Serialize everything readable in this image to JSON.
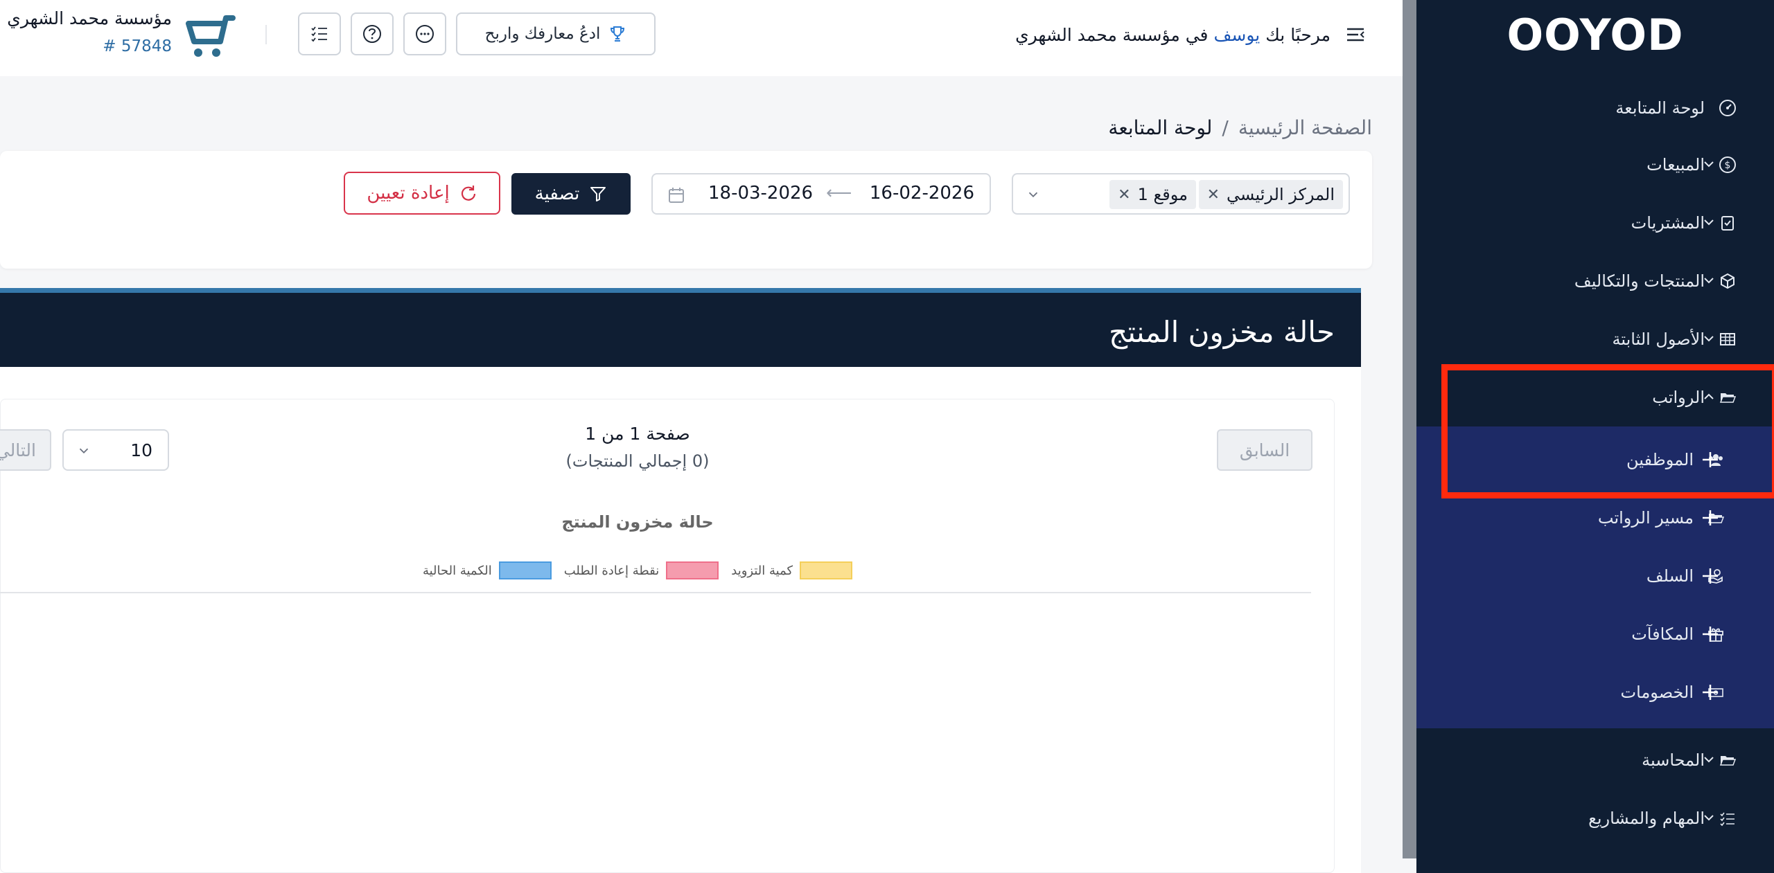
{
  "sidebar": {
    "logo": "OOYOD",
    "items": [
      {
        "label": "لوحة المتابعة"
      },
      {
        "label": "المبيعات"
      },
      {
        "label": "المشتريات"
      },
      {
        "label": "المنتجات والتكاليف"
      },
      {
        "label": "الأصول الثابتة"
      },
      {
        "label": "الرواتب"
      },
      {
        "label": "المحاسبة"
      },
      {
        "label": "المهام والمشاريع"
      }
    ],
    "payroll_sub": [
      {
        "label": "الموظفين"
      },
      {
        "label": "مسير الرواتب"
      },
      {
        "label": "السلف"
      },
      {
        "label": "المكافآت"
      },
      {
        "label": "الخصومات"
      }
    ]
  },
  "header": {
    "welcome_prefix": "مرحبًا بك",
    "user_name": "يوسف",
    "welcome_suffix": "في مؤسسة محمد الشهري",
    "invite_label": "ادعُ معارفك واربح",
    "company_name": "مؤسسة محمد الشهري",
    "company_id": "# 57848"
  },
  "breadcrumb": {
    "home": "الصفحة الرئيسية",
    "separator": "/",
    "current": "لوحة المتابعة"
  },
  "filters": {
    "locations": [
      "المركز الرئيسي",
      "موقع 1"
    ],
    "date_from": "16-02-2026",
    "date_to": "18-03-2026",
    "filter_label": "تصفية",
    "reset_label": "إعادة تعيين"
  },
  "stock": {
    "title": "حالة مخزون المنتج",
    "prev_label": "السابق",
    "next_label": "التالي",
    "page_info": "صفحة 1 من 1",
    "total_info": "(0 إجمالي المنتجات)",
    "page_size": "10"
  },
  "chart_data": {
    "type": "bar",
    "title": "حالة مخزون المنتج",
    "categories": [],
    "series": [
      {
        "name": "كمية التزويد",
        "color": "#fbe08f",
        "values": []
      },
      {
        "name": "نقطة إعادة الطلب",
        "color": "#f59cae",
        "values": []
      },
      {
        "name": "الكمية الحالية",
        "color": "#7db9ec",
        "values": []
      }
    ],
    "legend_position": "top"
  },
  "colors": {
    "sidebar_bg": "#0f1e33",
    "submenu_bg": "#1d2a66",
    "highlight": "#ff2a0e",
    "primary_dark": "#142238",
    "reset_red": "#d32f45",
    "section_accent": "#3578ab"
  }
}
